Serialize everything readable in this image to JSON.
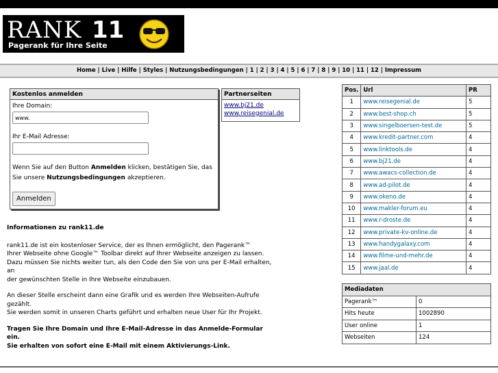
{
  "logo": {
    "word": "RANK",
    "number": "11",
    "tagline": "Pagerank für Ihre Seite"
  },
  "nav": {
    "items": [
      "Home",
      "Live",
      "Hilfe",
      "Styles",
      "Nutzungsbedingungen",
      "1",
      "2",
      "3",
      "4",
      "5",
      "6",
      "7",
      "8",
      "9",
      "10",
      "11",
      "12",
      "Impressum"
    ],
    "separator": " | "
  },
  "register": {
    "title": "Kostenlos anmelden",
    "domain_label": "Ihre Domain:",
    "domain_value": "www.",
    "email_label": "Ihr E-Mail Adresse:",
    "email_value": "",
    "note_pre": "Wenn Sie auf den Button ",
    "note_bold1": "Anmelden",
    "note_mid": " klicken, bestätigen Sie, das Sie unsere ",
    "note_bold2": "Nutzungsbedingungen",
    "note_post": " akzeptieren.",
    "button": "Anmelden"
  },
  "partner": {
    "title": "Partnerseiten",
    "links": [
      "www.bj21.de",
      "www.reisegenial.de"
    ]
  },
  "info": {
    "heading": "Informationen zu rank11.de",
    "p1": [
      "rank11.de ist ein kostenloser Service, der es Ihnen ermöglicht, den Pagerank™",
      "Ihrer Webseite ohne Google™ Toolbar direkt auf Ihrer Webseite anzeigen zu lassen.",
      "Dazu müssen Sie nichts weiter tun, als den Code den Sie von uns per E-Mail erhalten, an",
      "der gewünschten Stelle in Ihre Webseite einzubauen."
    ],
    "p2": [
      "An dieser Stelle erscheint dann eine Grafik und es werden Ihre Webseiten-Aufrufe gezählt.",
      "Sie werden somit in unseren Charts geführt und erhalten neue User für Ihr Projekt."
    ],
    "p3": [
      "Tragen Sie Ihre Domain und Ihre E-Mail-Adresse in das Anmelde-Formular ein.",
      "Sie erhalten von sofort eine E-Mail mit einem Aktivierungs-Link."
    ]
  },
  "ranking": {
    "headers": [
      "Pos.",
      "Url",
      "PR"
    ],
    "rows": [
      [
        "1",
        "www.reisegenial.de",
        "5"
      ],
      [
        "2",
        "www.best-shop.ch",
        "5"
      ],
      [
        "3",
        "www.singelboersen-test.de",
        "5"
      ],
      [
        "4",
        "www.kredit-partner.com",
        "4"
      ],
      [
        "5",
        "www.linktools.de",
        "4"
      ],
      [
        "6",
        "www.bj21.de",
        "4"
      ],
      [
        "7",
        "www.awacs-collection.de",
        "4"
      ],
      [
        "8",
        "www.ad-pilot.de",
        "4"
      ],
      [
        "9",
        "www.okeno.de",
        "4"
      ],
      [
        "10",
        "www.makler-forum.eu",
        "4"
      ],
      [
        "11",
        "www.r-droste.de",
        "4"
      ],
      [
        "12",
        "www.private-kv-online.de",
        "4"
      ],
      [
        "13",
        "www.handygalaxy.com",
        "4"
      ],
      [
        "14",
        "www.filme-und-mehr.de",
        "4"
      ],
      [
        "15",
        "www.jaal.de",
        "4"
      ]
    ]
  },
  "media": {
    "title": "Mediadaten",
    "rows": [
      [
        "Pagerank™",
        "0"
      ],
      [
        "Hits heute",
        "1002890"
      ],
      [
        "User online",
        "1"
      ],
      [
        "Webseiten",
        "124"
      ]
    ]
  },
  "colors": {
    "link": "#006699",
    "header_bg": "#e4e4e4",
    "navbar_bg": "#e8e8e8"
  }
}
